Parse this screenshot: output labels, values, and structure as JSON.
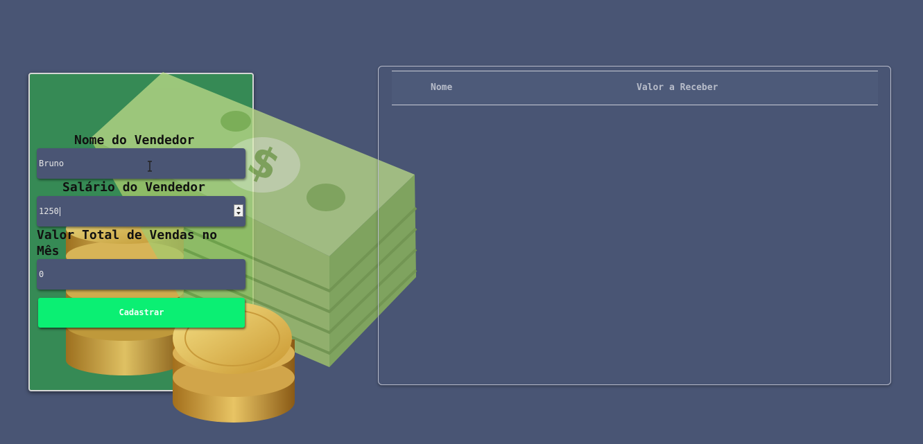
{
  "form": {
    "seller_name_label": "Nome do Vendedor",
    "seller_name_value": "Bruno",
    "seller_salary_label": "Salário do Vendedor",
    "seller_salary_value": "1250",
    "total_sales_label_line1": "Valor Total de Vendas no",
    "total_sales_label_line2": "Mês",
    "total_sales_value": "0",
    "submit_label": "Cadastrar"
  },
  "table": {
    "columns": [
      "Nome",
      "Valor a Receber"
    ],
    "rows": []
  },
  "colors": {
    "background": "#495574",
    "form_card": "#368a55",
    "submit_button": "#0bef73",
    "input": "#4a5574"
  }
}
